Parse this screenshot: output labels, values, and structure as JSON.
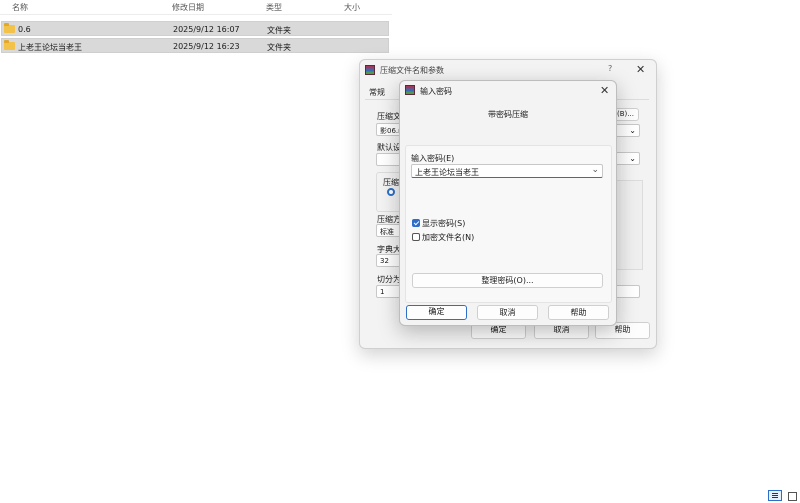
{
  "file_list": {
    "headers": {
      "name": "名称",
      "modified": "修改日期",
      "type": "类型",
      "size": "大小"
    },
    "rows": [
      {
        "name": "0.6",
        "modified": "2025/9/12 16:07",
        "type": "文件夹"
      },
      {
        "name": "上老王论坛当老王",
        "modified": "2025/9/12 16:23",
        "type": "文件夹"
      }
    ]
  },
  "archive_dialog": {
    "title": "压缩文件名和参数",
    "help_glyph": "?",
    "close_glyph": "✕",
    "tab_general": "常规",
    "archive_name_label": "压缩文",
    "archive_name_value": "影06.r",
    "default_label": "默认设",
    "compress_group": "压缩",
    "method_label": "压缩方",
    "method_value": "标准",
    "dict_label": "字典大",
    "dict_value": "32",
    "split_label": "切分为",
    "split_value": "1",
    "browse_label": "(B)...",
    "ok": "确定",
    "cancel": "取消",
    "help": "帮助"
  },
  "password_dialog": {
    "title": "输入密码",
    "close_glyph": "✕",
    "heading": "带密码压缩",
    "password_label": "输入密码(E)",
    "password_value": "上老王论坛当老王",
    "show_password_label": "显示密码(S)",
    "show_password_checked": true,
    "encrypt_names_label": "加密文件名(N)",
    "encrypt_names_checked": false,
    "organize_button": "整理密码(O)...",
    "ok": "确定",
    "cancel": "取消",
    "help": "帮助"
  }
}
